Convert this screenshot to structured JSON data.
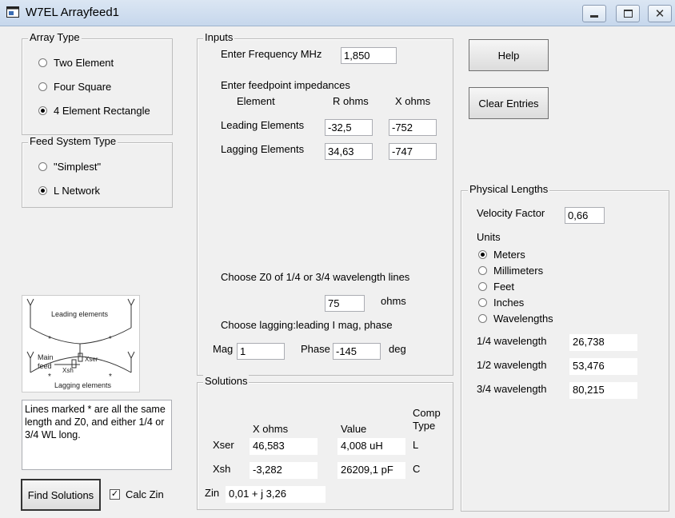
{
  "window": {
    "title": "W7EL Arrayfeed1"
  },
  "array_type": {
    "legend": "Array Type",
    "options": [
      {
        "label": "Two Element",
        "selected": false
      },
      {
        "label": "Four Square",
        "selected": false
      },
      {
        "label": "4 Element Rectangle",
        "selected": true
      }
    ]
  },
  "feed_system": {
    "legend": "Feed System Type",
    "options": [
      {
        "label": "\"Simplest\"",
        "selected": false
      },
      {
        "label": "L Network",
        "selected": true
      }
    ]
  },
  "inputs": {
    "legend": "Inputs",
    "freq_label": "Enter Frequency MHz",
    "freq_value": "1,850",
    "impedance_heading": "Enter feedpoint impedances",
    "col_element": "Element",
    "col_r": "R ohms",
    "col_x": "X ohms",
    "leading_label": "Leading Elements",
    "leading_r": "-32,5",
    "leading_x": "-752",
    "lagging_label": "Lagging Elements",
    "lagging_r": "34,63",
    "lagging_x": "-747",
    "z0_label": "Choose Z0 of 1/4 or 3/4 wavelength lines",
    "z0_value": "75",
    "z0_unit": "ohms",
    "ratio_label": "Choose lagging:leading I mag, phase",
    "mag_label": "Mag",
    "mag_value": "1",
    "phase_label": "Phase",
    "phase_value": "-145",
    "phase_unit": "deg"
  },
  "buttons": {
    "help": "Help",
    "clear": "Clear Entries",
    "find": "Find Solutions"
  },
  "calc_zin": {
    "label": "Calc Zin",
    "checked": true
  },
  "diagram": {
    "leading": "Leading elements",
    "lagging": "Lagging elements",
    "main_feed_1": "Main",
    "main_feed_2": "feed",
    "xsh": "Xsh",
    "xser": "Xser",
    "star": "*"
  },
  "note": "Lines marked * are all the same length and Z0, and either 1/4 or 3/4 WL long.",
  "solutions": {
    "legend": "Solutions",
    "col_x": "X ohms",
    "col_value": "Value",
    "col_comp1": "Comp",
    "col_comp2": "Type",
    "rows": [
      {
        "name": "Xser",
        "x": "46,583",
        "value": "4,008 uH",
        "type": "L"
      },
      {
        "name": "Xsh",
        "x": "-3,282",
        "value": "26209,1 pF",
        "type": "C"
      }
    ],
    "zin_label": "Zin",
    "zin_value": "0,01 + j 3,26"
  },
  "physical": {
    "legend": "Physical Lengths",
    "vf_label": "Velocity Factor",
    "vf_value": "0,66",
    "units_label": "Units",
    "units": [
      {
        "label": "Meters",
        "selected": true
      },
      {
        "label": "Millimeters",
        "selected": false
      },
      {
        "label": "Feet",
        "selected": false
      },
      {
        "label": "Inches",
        "selected": false
      },
      {
        "label": "Wavelengths",
        "selected": false
      }
    ],
    "lengths": [
      {
        "label": "1/4 wavelength",
        "value": "26,738"
      },
      {
        "label": "1/2 wavelength",
        "value": "53,476"
      },
      {
        "label": "3/4 wavelength",
        "value": "80,215"
      }
    ]
  },
  "icons": {
    "app": "window-app-icon",
    "minimize": "minimize-icon",
    "maximize": "maximize-icon",
    "close": "close-icon"
  }
}
